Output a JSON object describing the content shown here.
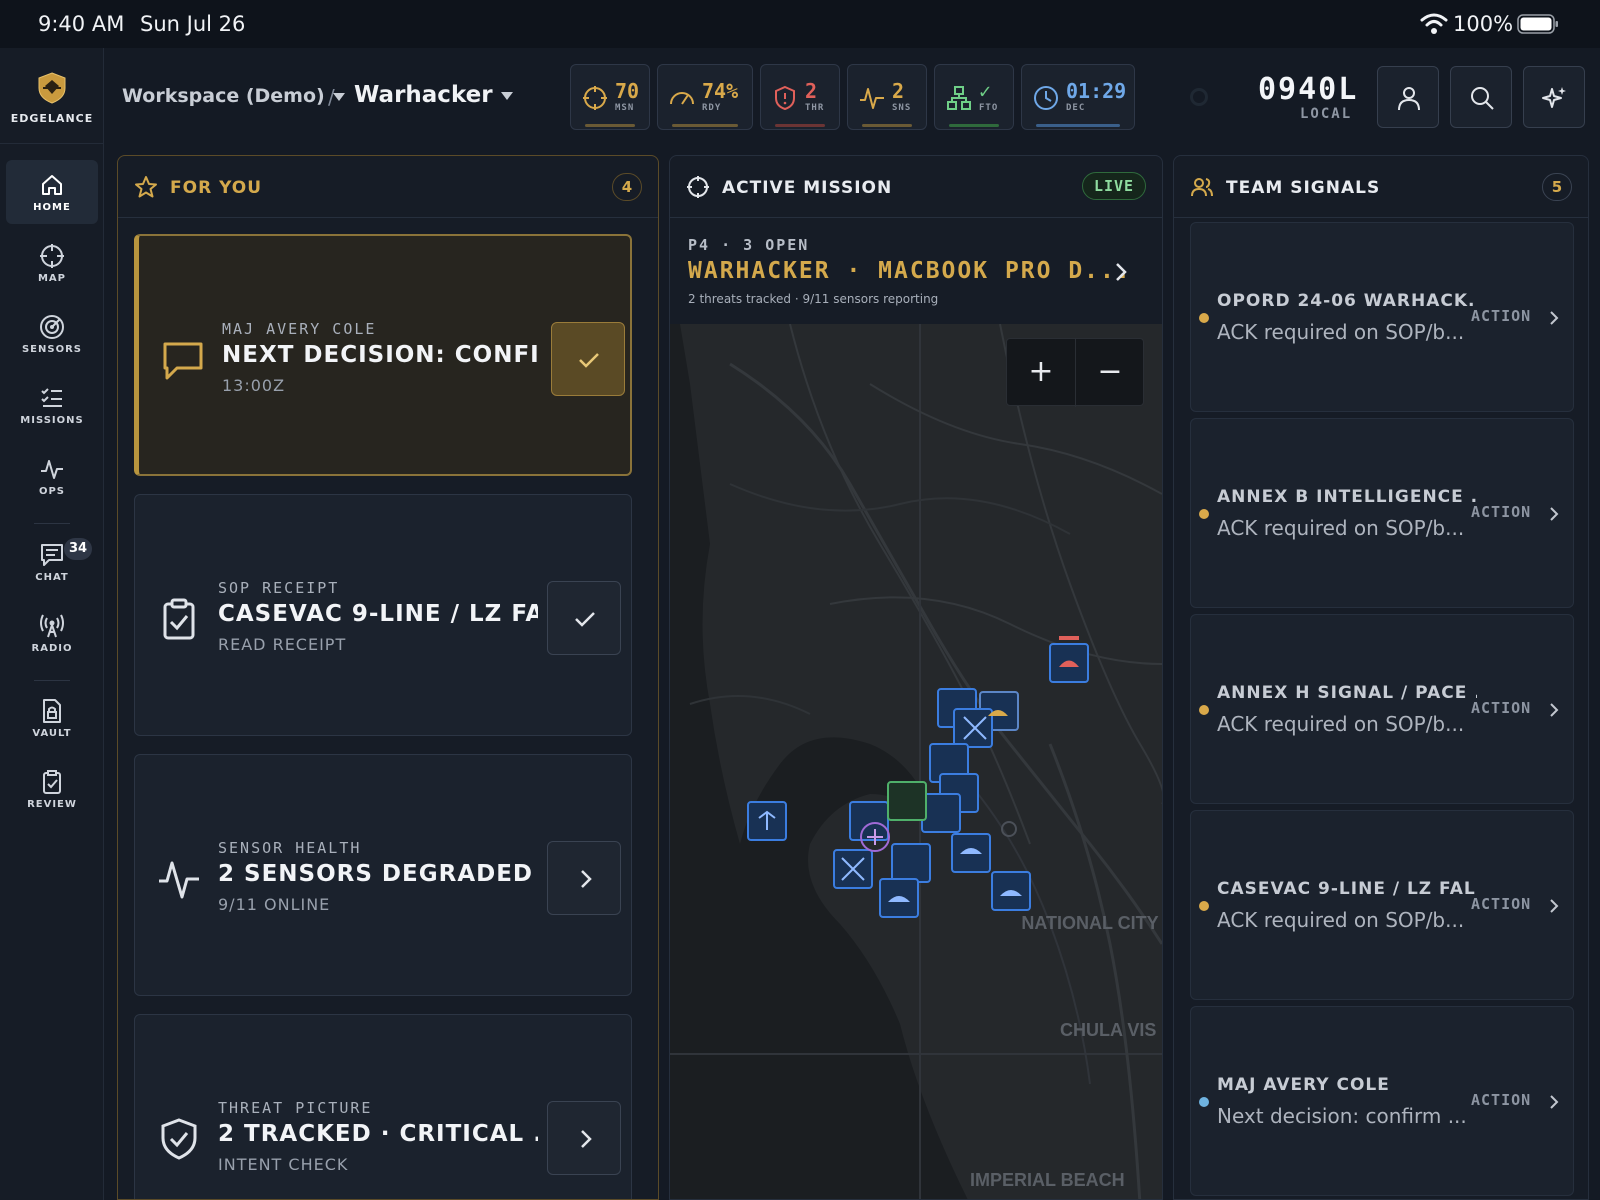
{
  "status_bar": {
    "time": "9:40 AM",
    "date": "Sun Jul 26",
    "battery": "100%"
  },
  "brand": {
    "name": "EDGELANCE"
  },
  "nav": {
    "home": "HOME",
    "map": "MAP",
    "sensors": "SENSORS",
    "missions": "MISSIONS",
    "ops": "OPS",
    "chat": "CHAT",
    "chat_badge": "34",
    "radio": "RADIO",
    "vault": "VAULT",
    "review": "REVIEW"
  },
  "breadcrumb": {
    "workspace": "Workspace (Demo)",
    "separator": "/",
    "project": "Warhacker"
  },
  "metrics": [
    {
      "value": "70",
      "label": "MSN",
      "color": "#d9a94a"
    },
    {
      "value": "74%",
      "label": "RDY",
      "color": "#d9a94a"
    },
    {
      "value": "2",
      "label": "THR",
      "color": "#e0605a"
    },
    {
      "value": "2",
      "label": "SNS",
      "color": "#d9a94a"
    },
    {
      "value": "✓",
      "label": "FTO",
      "color": "#6fcf87"
    },
    {
      "value": "01:29",
      "label": "DEC",
      "color": "#6fa8e8"
    }
  ],
  "clock": {
    "time": "0940L",
    "zone": "LOCAL"
  },
  "for_you": {
    "title": "FOR YOU",
    "count": "4",
    "cards": [
      {
        "kicker": "MAJ AVERY COLE",
        "title": "NEXT DECISION: CONFI...",
        "meta": "13:00Z"
      },
      {
        "kicker": "SOP RECEIPT",
        "title": "CASEVAC 9-LINE / LZ FA...",
        "meta": "READ RECEIPT"
      },
      {
        "kicker": "SENSOR HEALTH",
        "title": "2 SENSORS DEGRADED",
        "meta": "9/11 ONLINE"
      },
      {
        "kicker": "THREAT PICTURE",
        "title": "2 TRACKED · CRITICAL ...",
        "meta": "INTENT CHECK"
      }
    ]
  },
  "mission": {
    "title": "ACTIVE MISSION",
    "status": "LIVE",
    "kicker": "P4 · 3 OPEN",
    "name": "WARHACKER · MACBOOK PRO D...",
    "meta": "2 threats tracked · 9/11 sensors reporting",
    "map_labels": {
      "national_city": "NATIONAL CITY",
      "chula_vista": "CHULA VIS",
      "imperial_beach": "IMPERIAL BEACH"
    },
    "zoom_in": "+",
    "zoom_out": "−"
  },
  "team_signals": {
    "title": "TEAM SIGNALS",
    "count": "5",
    "items": [
      {
        "title": "OPORD 24-06 WARHACK...",
        "sub": "ACK required on SOP/b...",
        "action": "ACTION",
        "dot": "#d9a94a"
      },
      {
        "title": "ANNEX B INTELLIGENCE ...",
        "sub": "ACK required on SOP/b...",
        "action": "ACTION",
        "dot": "#d9a94a"
      },
      {
        "title": "ANNEX H SIGNAL / PACE ...",
        "sub": "ACK required on SOP/b...",
        "action": "ACTION",
        "dot": "#d9a94a"
      },
      {
        "title": "CASEVAC 9-LINE / LZ FAL...",
        "sub": "ACK required on SOP/b...",
        "action": "ACTION",
        "dot": "#d9a94a"
      },
      {
        "title": "MAJ AVERY COLE",
        "sub": "Next decision: confirm ...",
        "action": "ACTION",
        "dot": "#6fb3e0"
      }
    ]
  }
}
